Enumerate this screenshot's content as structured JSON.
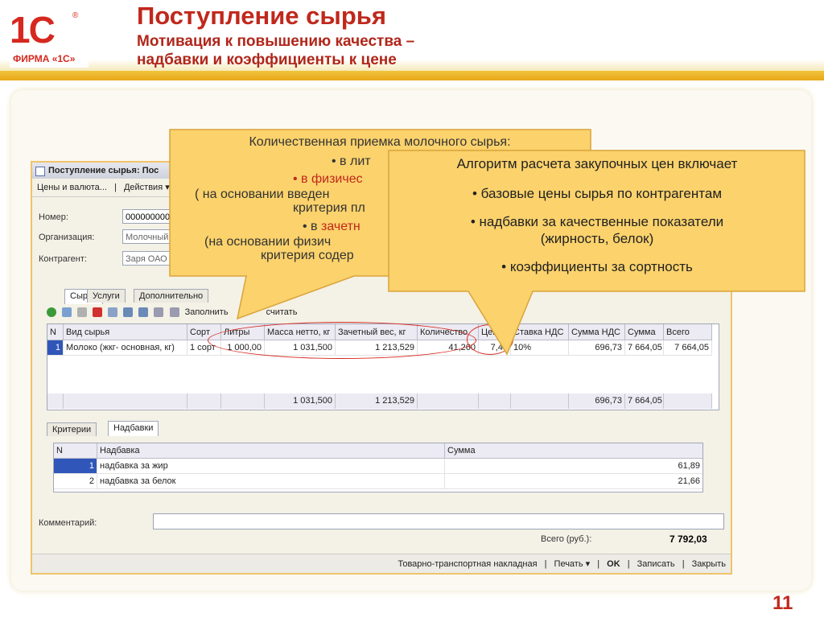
{
  "slide": {
    "title": "Поступление сырья",
    "subtitle_line1": "Мотивация к повышению качества –",
    "subtitle_line2": "надбавки и коэффициенты к цене",
    "page_number": "11",
    "logo_mark": "1С",
    "logo_reg": "®",
    "logo_text": "ФИРМА «1С»"
  },
  "form": {
    "title": "Поступление сырья: Пос",
    "menu": [
      "Цены и валюта...",
      "Действия ▾"
    ],
    "fields": {
      "number_label": "Номер:",
      "number_value": "0000000000",
      "org_label": "Организация:",
      "org_value": "Молочный",
      "contractor_label": "Контрагент:",
      "contractor_value": "Заря ОАО"
    },
    "tabs": [
      "Сырье",
      "Услуги",
      "Дополнительно"
    ],
    "toolbar": {
      "fill": "Заполнить",
      "recalc": "считать"
    },
    "grid": {
      "headers": [
        "N",
        "Вид сырья",
        "Сорт",
        "Литры",
        "Масса нетто, кг",
        "Зачетный вес, кг",
        "Количество",
        "Цена",
        "Ставка НДС",
        "Сумма НДС",
        "Сумма",
        "Всего"
      ],
      "row": [
        "1",
        "Молоко (жкг- основная, кг)",
        "1 сорт",
        "1 000,00",
        "1 031,500",
        "1 213,529",
        "41,260",
        "7,43",
        "10%",
        "696,73",
        "7 664,05",
        "7 664,05"
      ],
      "totals": {
        "mass": "1 031,500",
        "weight": "1 213,529",
        "vat": "696,73",
        "sum": "7 664,05"
      }
    },
    "subtabs": [
      "Критерии",
      "Надбавки"
    ],
    "subgrid": {
      "headers": [
        "N",
        "Надбавка",
        "Сумма"
      ],
      "rows": [
        {
          "n": "1",
          "name": "надбавка за жир",
          "sum": "61,89"
        },
        {
          "n": "2",
          "name": "надбавка за белок",
          "sum": "21,66"
        }
      ]
    },
    "comment_label": "Комментарий:",
    "total_label": "Всего (руб.):",
    "total_value": "7 792,03",
    "status": [
      "Товарно-транспортная накладная",
      "Печать ▾",
      "OK",
      "Записать",
      "Закрыть"
    ]
  },
  "callout1": {
    "line1": "Количественная приемка молочного сырья:",
    "line2": "• в лит",
    "line3": "• в физичес",
    "line4": "( на основании введен",
    "line5": "критерия пл",
    "line6a": "• в ",
    "line6b": "зачетн",
    "line7": "(на основании физич",
    "line8": "критерия содер"
  },
  "callout2": {
    "heading": "Алгоритм расчета закупочных цен включает",
    "item1": "• базовые цены сырья по контрагентам",
    "item2": "• надбавки за качественные показатели",
    "item2b": "(жирность, белок)",
    "item3": "• коэффициенты за сортность"
  },
  "colors": {
    "accent_red": "#c0281c",
    "callout_fill": "#fbd26c",
    "header_stripe": "#e8a619"
  }
}
